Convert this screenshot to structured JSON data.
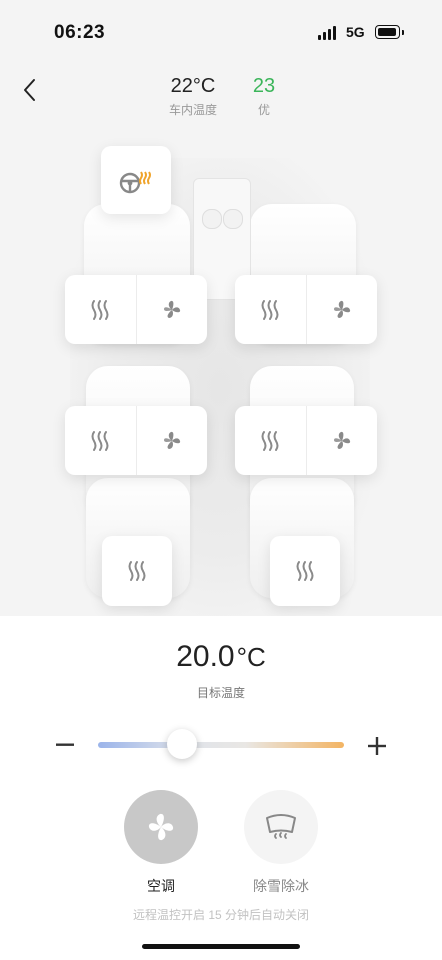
{
  "status_bar": {
    "time": "06:23",
    "network": "5G"
  },
  "header": {
    "cabin_temp": "22°C",
    "cabin_temp_label": "车内温度",
    "aqi_value": "23",
    "aqi_label": "优"
  },
  "target": {
    "value": "20.0",
    "unit": "°C",
    "label": "目标温度"
  },
  "slider": {
    "min_label": "−",
    "max_label": "+",
    "position_fraction": 0.34
  },
  "modes": {
    "ac_label": "空调",
    "defrost_label": "除雪除冰"
  },
  "footnote": "远程温控开启 15 分钟后自动关闭",
  "colors": {
    "accent_green": "#3bb55a",
    "heat_icon_orange": "#f0a42b",
    "slider_cold": "#9bb4ea",
    "slider_warm": "#f3b463"
  }
}
